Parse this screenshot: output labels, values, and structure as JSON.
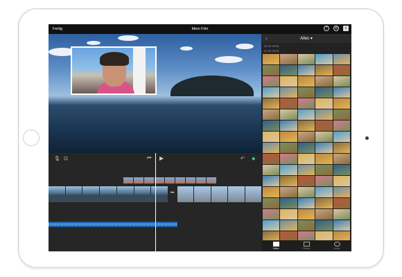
{
  "topbar": {
    "done_label": "Fertig",
    "title": "Mein Film",
    "help_icon": "?",
    "settings_icon": "⚙",
    "share_icon": "⇪"
  },
  "media_browser": {
    "back_label": "‹",
    "filter_label": "Alles ▾",
    "dates": [
      "13.03.2016",
      "12.03.2016"
    ]
  },
  "editor_controls": {
    "mic_icon": "🎙",
    "camera_icon": "⊡",
    "skip_back_icon": "⏮",
    "play_icon": "▶",
    "undo_icon": "↶",
    "settings_icon": "◆"
  },
  "tabs": [
    {
      "label": "Video"
    },
    {
      "label": "Photos"
    },
    {
      "label": "Audio"
    }
  ],
  "colors": {
    "accent": "#4aa3ff",
    "audio_track": "#1a5ea6"
  }
}
